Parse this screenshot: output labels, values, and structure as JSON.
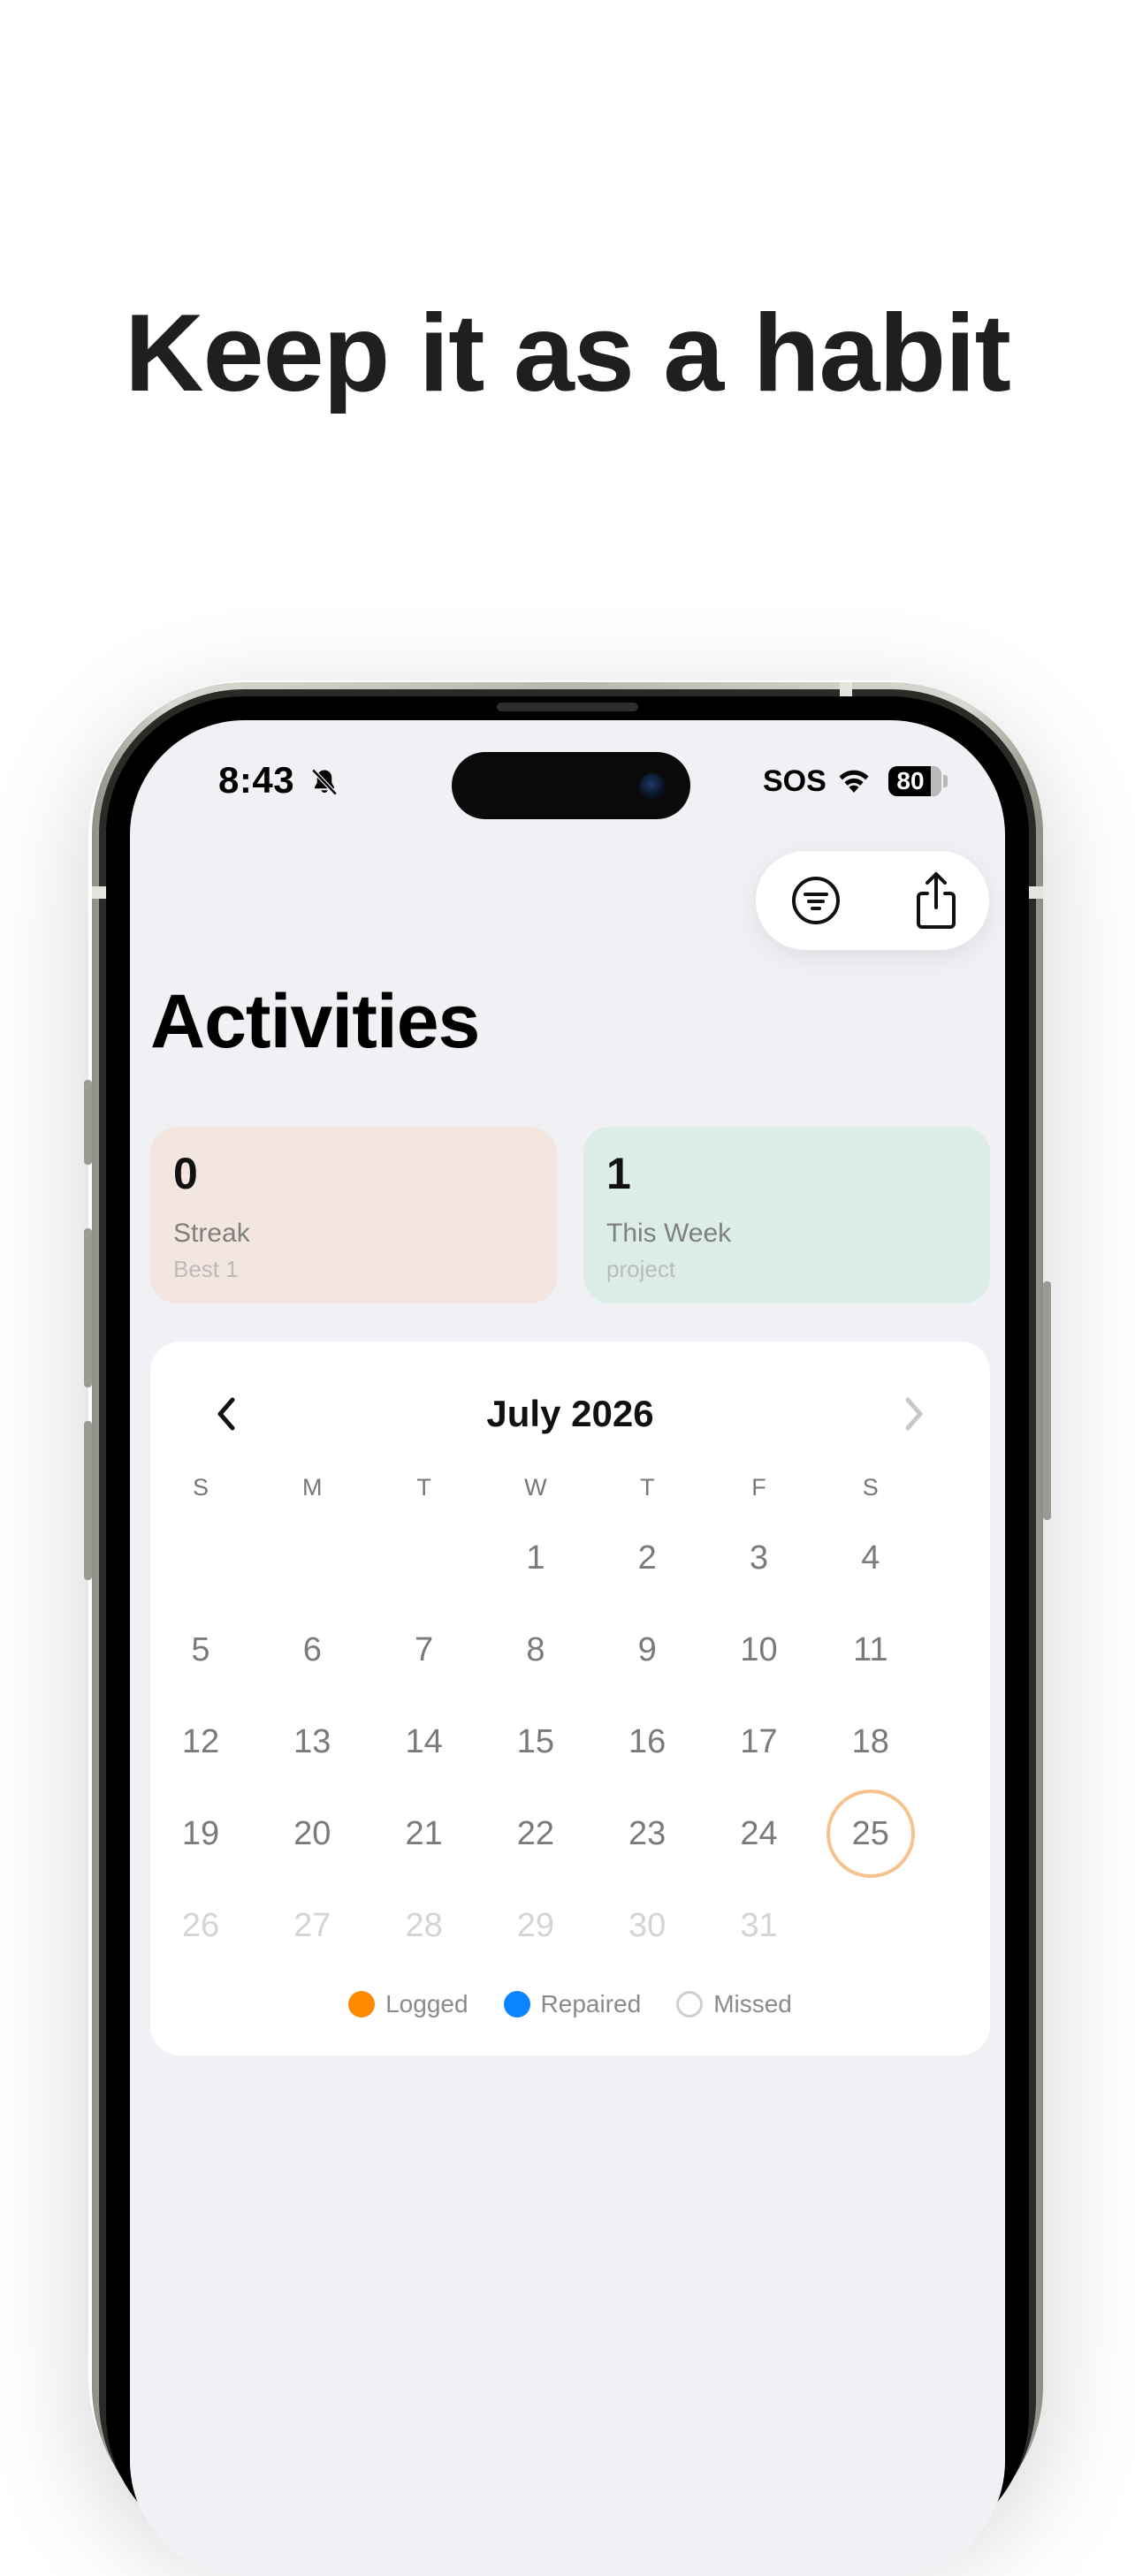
{
  "headline": "Keep it as a habit",
  "status_bar": {
    "time": "8:43",
    "sos": "SOS",
    "battery": "80",
    "icons": [
      "bell-slash-icon",
      "wifi-icon",
      "battery-icon"
    ]
  },
  "toolbar": {
    "icons": [
      "filter-icon",
      "share-icon"
    ]
  },
  "page_title": "Activities",
  "stats": {
    "streak": {
      "value": "0",
      "label": "Streak",
      "sub": "Best 1"
    },
    "week": {
      "value": "1",
      "label": "This Week",
      "sub": "project"
    }
  },
  "calendar": {
    "month": "July 2026",
    "weekdays": [
      "S",
      "M",
      "T",
      "W",
      "T",
      "F",
      "S"
    ],
    "first_weekday_index": 3,
    "days_in_month": 31,
    "today": 25,
    "legend": [
      {
        "label": "Logged",
        "color": "#ff8a00",
        "style": "filled"
      },
      {
        "label": "Repaired",
        "color": "#0a84ff",
        "style": "filled"
      },
      {
        "label": "Missed",
        "color": "#cfcfcf",
        "style": "outline"
      }
    ]
  },
  "colors": {
    "streak_card": "#f3e6df",
    "week_card": "#dbede6",
    "today_ring": "#f6c38e",
    "screen_bg": "#f0f0f5"
  }
}
